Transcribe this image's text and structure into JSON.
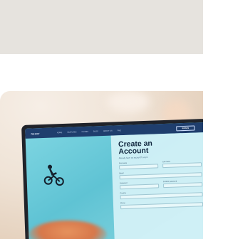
{
  "site": {
    "logo": "nexor",
    "nav_links": [
      "HOME",
      "FEATURES",
      "GUIDES",
      "BLOG",
      "ABOUT US",
      "FAQ"
    ],
    "nav_button": "SIGN IN"
  },
  "form": {
    "title_line1": "Create an",
    "title_line2": "Account",
    "subtitle": "Already have an account? Log in",
    "fields": [
      {
        "label": "First name"
      },
      {
        "label": "Last name"
      },
      {
        "label": "Email"
      },
      {
        "label": "Password"
      },
      {
        "label": "Confirm password"
      },
      {
        "label": "Country"
      },
      {
        "label": "Phone"
      }
    ]
  },
  "icons": {
    "rider": "bmx-rider-icon"
  }
}
